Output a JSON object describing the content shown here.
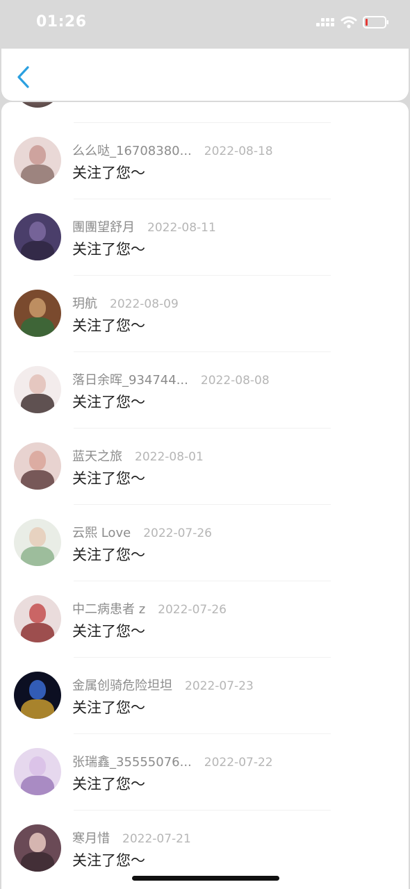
{
  "status_bar": {
    "time": "01:26",
    "battery_color": "#e53935"
  },
  "header": {
    "back_icon": "chevron-left-icon",
    "accent_color": "#2ba0e0"
  },
  "notifications": [
    {
      "username": "么么哒_16708380...",
      "date": "2022-08-18",
      "message": "关注了您～",
      "avatar_bg": "#e9d8d6",
      "avatar_face": "#c99a94",
      "avatar_body": "#8a6f69"
    },
    {
      "username": "團團望舒月",
      "date": "2022-08-11",
      "message": "关注了您～",
      "avatar_bg": "#4a3e6a",
      "avatar_face": "#7c6aa0",
      "avatar_body": "#2d2540"
    },
    {
      "username": "玥航",
      "date": "2022-08-09",
      "message": "关注了您～",
      "avatar_bg": "#7a4a2e",
      "avatar_face": "#c99a6a",
      "avatar_body": "#2f6b3a"
    },
    {
      "username": "落日余晖_934744...",
      "date": "2022-08-08",
      "message": "关注了您～",
      "avatar_bg": "#f3ecec",
      "avatar_face": "#e2c1b8",
      "avatar_body": "#3a2a2a"
    },
    {
      "username": "蓝天之旅",
      "date": "2022-08-01",
      "message": "关注了您～",
      "avatar_bg": "#e8d3d0",
      "avatar_face": "#d9a59a",
      "avatar_body": "#5a3a3a"
    },
    {
      "username": "云熙 Love",
      "date": "2022-07-26",
      "message": "关注了您～",
      "avatar_bg": "#e9ede6",
      "avatar_face": "#e6cdb8",
      "avatar_body": "#8ab08a"
    },
    {
      "username": "中二病患者 z",
      "date": "2022-07-26",
      "message": "关注了您～",
      "avatar_bg": "#eadcdc",
      "avatar_face": "#c45050",
      "avatar_body": "#8a2a2a"
    },
    {
      "username": "金属创骑危险坦坦",
      "date": "2022-07-23",
      "message": "关注了您～",
      "avatar_bg": "#0c0f22",
      "avatar_face": "#3a6ad0",
      "avatar_body": "#d0a030"
    },
    {
      "username": "张瑞鑫_35555076...",
      "date": "2022-07-22",
      "message": "关注了您～",
      "avatar_bg": "#e6d8ee",
      "avatar_face": "#d8c0e6",
      "avatar_body": "#9a78b8"
    },
    {
      "username": "寒月惜",
      "date": "2022-07-21",
      "message": "关注了您～",
      "avatar_bg": "#6a4a56",
      "avatar_face": "#e8c8c0",
      "avatar_body": "#3a2830"
    }
  ]
}
